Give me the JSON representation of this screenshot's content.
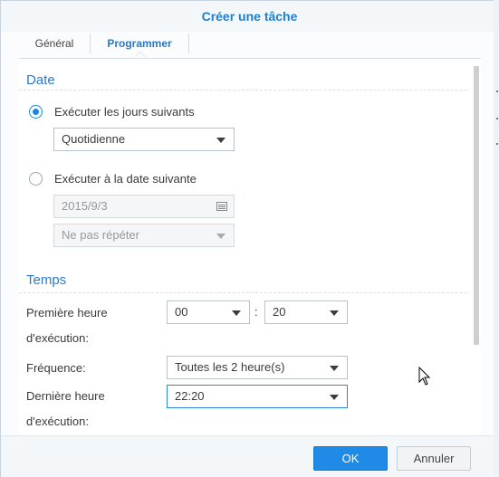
{
  "dialog": {
    "title": "Créer une tâche"
  },
  "tabs": [
    {
      "label": "Général",
      "active": false
    },
    {
      "label": "Programmer",
      "active": true
    }
  ],
  "date_section": {
    "title": "Date",
    "option_daily": {
      "label": "Exécuter les jours suivants",
      "checked": true,
      "select_value": "Quotidienne"
    },
    "option_date": {
      "label": "Exécuter à la date suivante",
      "checked": false,
      "date_value": "2015/9/3",
      "repeat_value": "Ne pas répéter"
    }
  },
  "time_section": {
    "title": "Temps",
    "first_run": {
      "label_line1": "Première heure",
      "label_line2": "d'exécution:",
      "hour": "00",
      "separator": ":",
      "minute": "20"
    },
    "frequency": {
      "label": "Fréquence:",
      "value": "Toutes les 2 heure(s)"
    },
    "last_run": {
      "label_line1": "Dernière heure",
      "label_line2": "d'exécution:",
      "value": "22:20"
    }
  },
  "buttons": {
    "ok": "OK",
    "cancel": "Annuler"
  },
  "colors": {
    "accent": "#1f8be6",
    "title": "#1f7fce",
    "section": "#2a7ad0"
  }
}
